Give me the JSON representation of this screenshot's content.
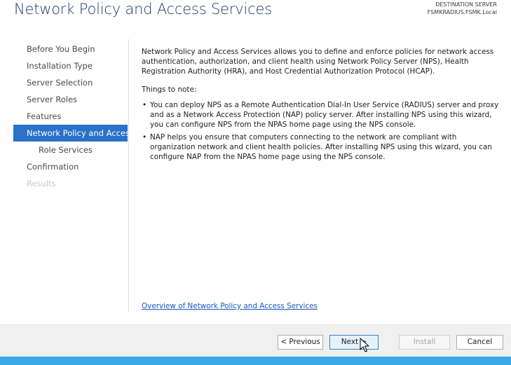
{
  "header": {
    "title": "Network Policy and Access Services",
    "destination_label": "DESTINATION SERVER",
    "destination_server": "FSMKRADIUS.FSMK.Local"
  },
  "nav": {
    "items": [
      {
        "label": "Before You Begin",
        "state": "normal"
      },
      {
        "label": "Installation Type",
        "state": "normal"
      },
      {
        "label": "Server Selection",
        "state": "normal"
      },
      {
        "label": "Server Roles",
        "state": "normal"
      },
      {
        "label": "Features",
        "state": "normal"
      },
      {
        "label": "Network Policy and Acces...",
        "state": "active"
      },
      {
        "label": "Role Services",
        "state": "normal"
      },
      {
        "label": "Confirmation",
        "state": "normal"
      },
      {
        "label": "Results",
        "state": "disabled"
      }
    ]
  },
  "content": {
    "intro": "Network Policy and Access Services allows you to define and enforce policies for network access authentication, authorization, and client health using Network Policy Server (NPS), Health Registration Authority (HRA), and Host Credential Authorization Protocol (HCAP).",
    "notes_title": "Things to note:",
    "bullet_symbol": "•",
    "bullets": [
      "You can deploy NPS as a Remote Authentication Dial-In User Service (RADIUS) server and proxy and as a Network Access Protection (NAP) policy server. After installing NPS using this wizard, you can configure NPS from the NPAS home page using the NPS console.",
      "NAP helps you ensure that computers connecting to the network are compliant with organization network and client health policies. After installing NPS using this wizard, you can configure NAP from the NPAS home page using the NPS console."
    ],
    "link_text": "Overview of Network Policy and Access Services"
  },
  "buttons": {
    "previous": "< Previous",
    "next": "Next >",
    "install": "Install",
    "cancel": "Cancel"
  },
  "colors": {
    "title": "#1f3a6e",
    "nav_active_bg": "#2a71c8",
    "link": "#1a56b8",
    "accent_bar": "#3aa7e6"
  },
  "icons": {
    "cursor": "mouse-pointer-icon"
  }
}
